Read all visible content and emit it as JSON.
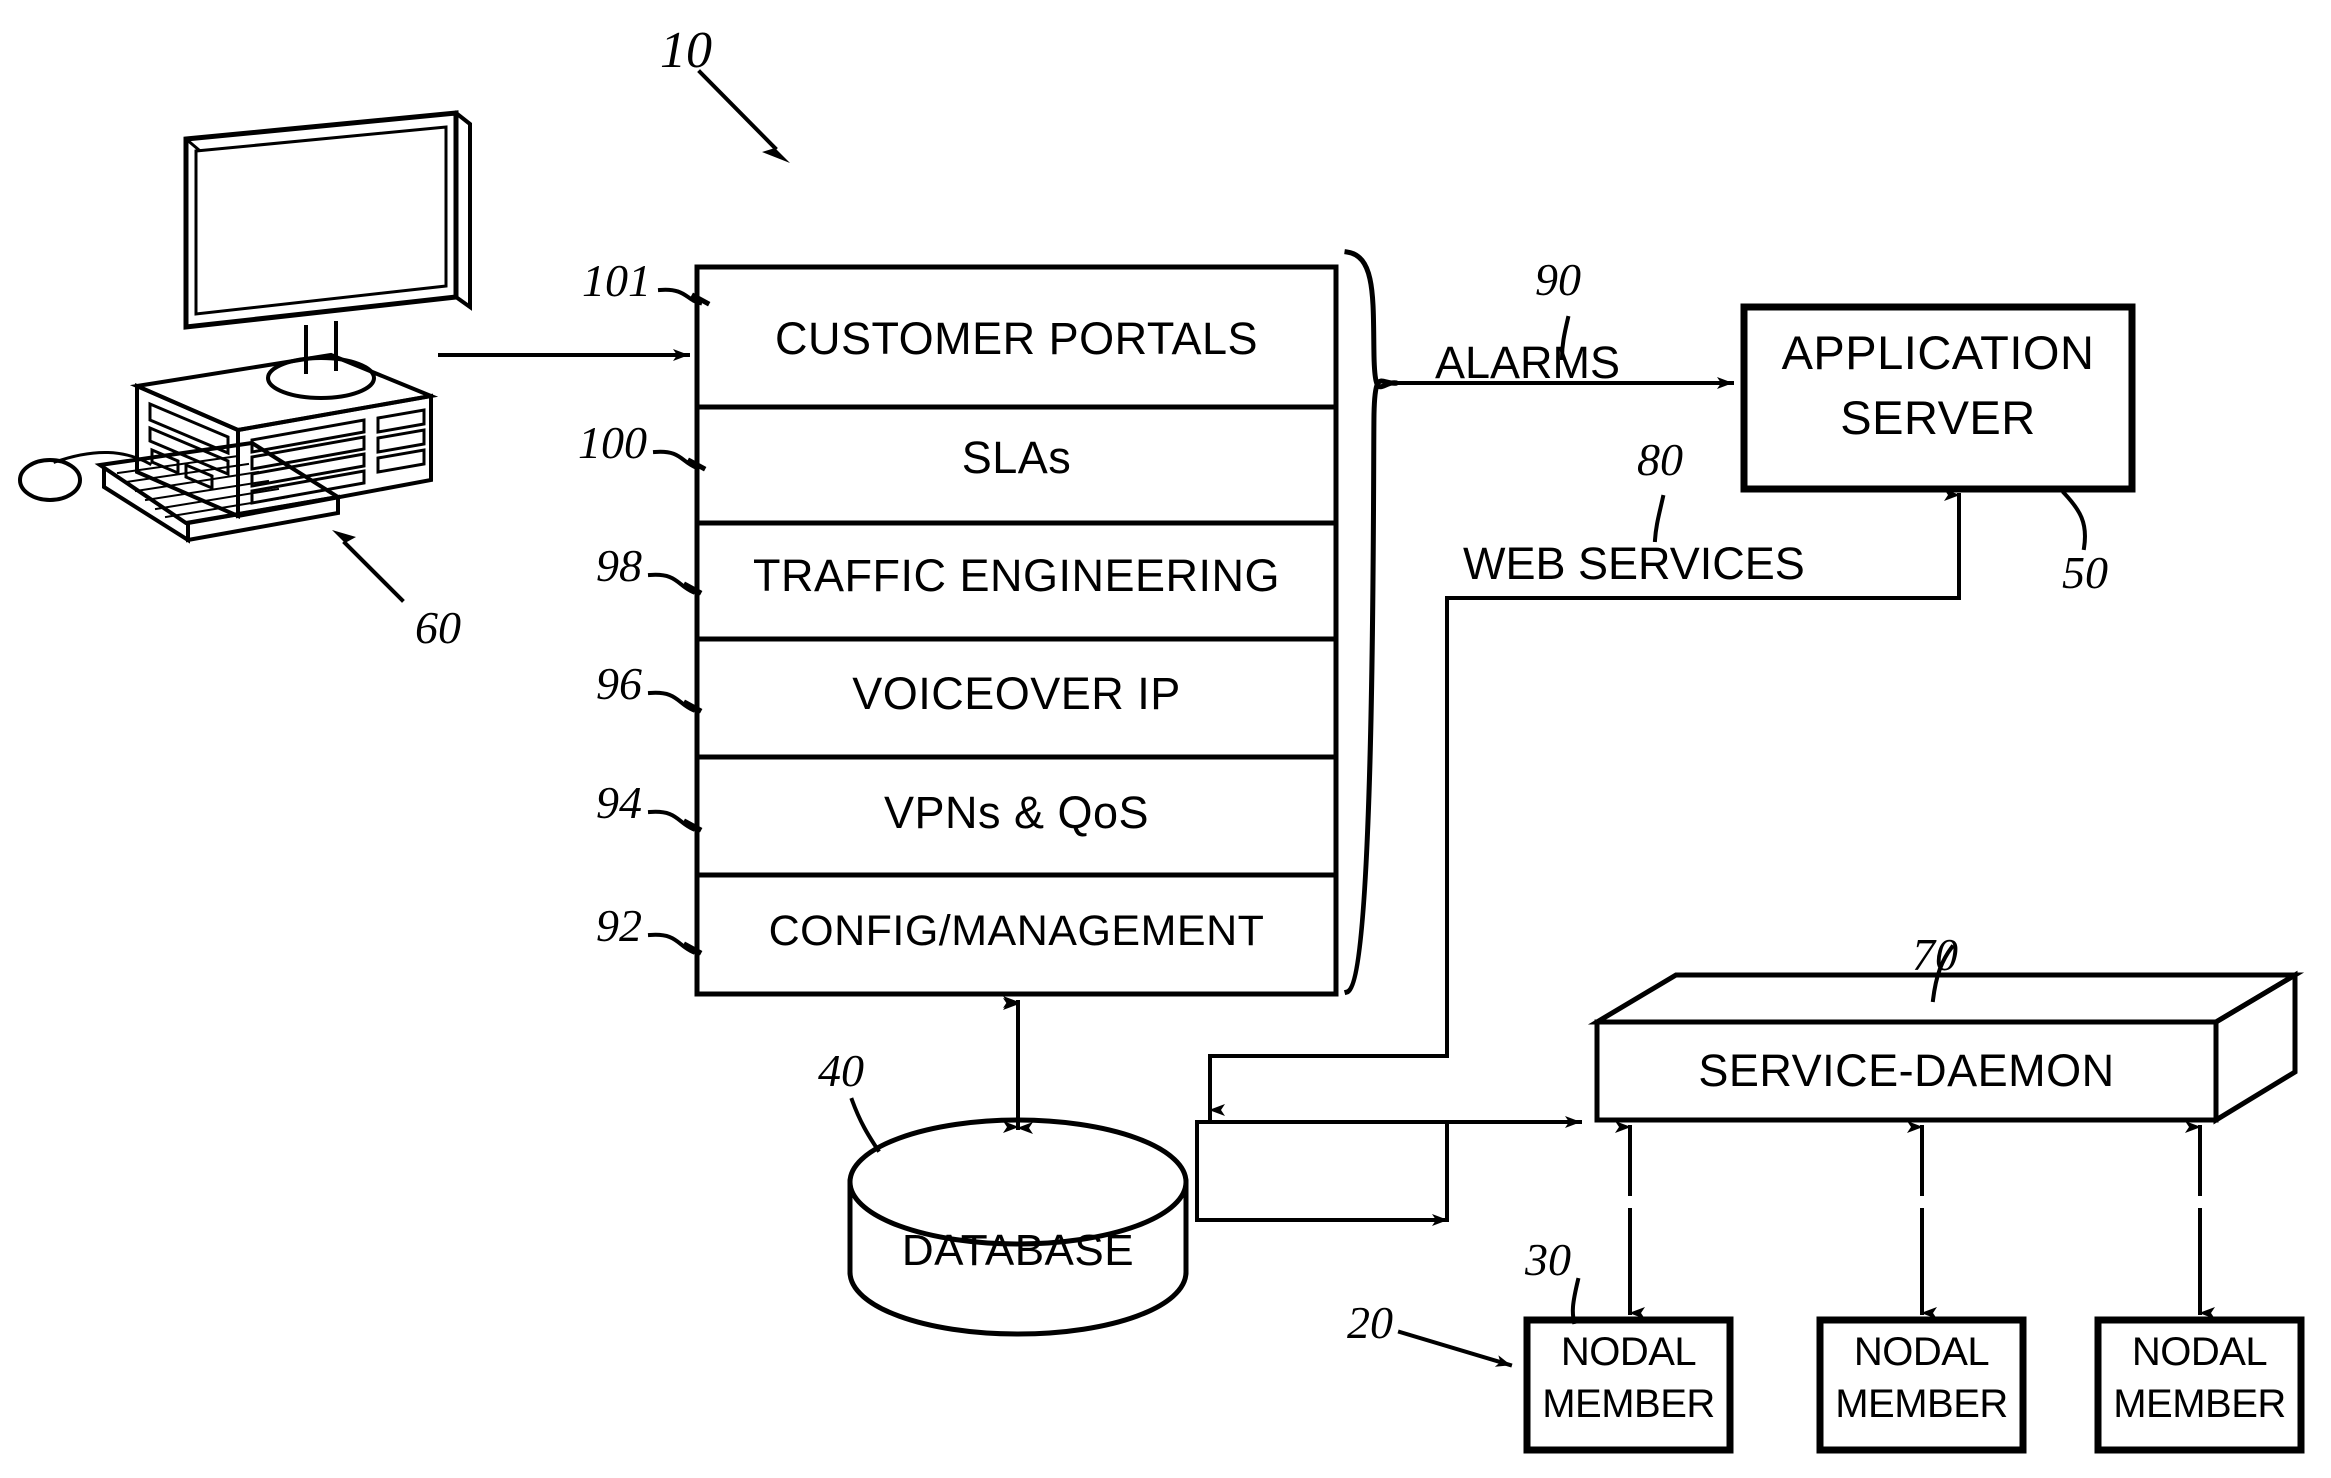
{
  "figure": {
    "title_ref": "10"
  },
  "workstation": {
    "ref": "60",
    "icon": "desktop-computer-illustration"
  },
  "stack": {
    "ref_outer": "100",
    "layers": [
      {
        "ref": "101",
        "label": "CUSTOMER PORTALS"
      },
      {
        "ref": "100",
        "label": "SLAs"
      },
      {
        "ref": "98",
        "label": "TRAFFIC ENGINEERING"
      },
      {
        "ref": "96",
        "label": "VOICEOVER IP"
      },
      {
        "ref": "94",
        "label": "VPNs & QoS"
      },
      {
        "ref": "92",
        "label": "CONFIG/MANAGEMENT"
      }
    ]
  },
  "connections": {
    "alarms": {
      "label": "ALARMS",
      "ref": "90"
    },
    "web_services": {
      "label": "WEB SERVICES",
      "ref": "80"
    }
  },
  "application_server": {
    "line1": "APPLICATION",
    "line2": "SERVER",
    "ref": "50"
  },
  "database": {
    "label": "DATABASE",
    "ref": "40"
  },
  "service_daemon": {
    "label": "SERVICE-DAEMON",
    "ref": "70"
  },
  "nodal_group": {
    "ref": "20",
    "first_ref": "30",
    "members": [
      {
        "line1": "NODAL",
        "line2": "MEMBER"
      },
      {
        "line1": "NODAL",
        "line2": "MEMBER"
      },
      {
        "line1": "NODAL",
        "line2": "MEMBER"
      }
    ]
  },
  "colors": {
    "ink": "#000000",
    "paper": "#ffffff"
  }
}
